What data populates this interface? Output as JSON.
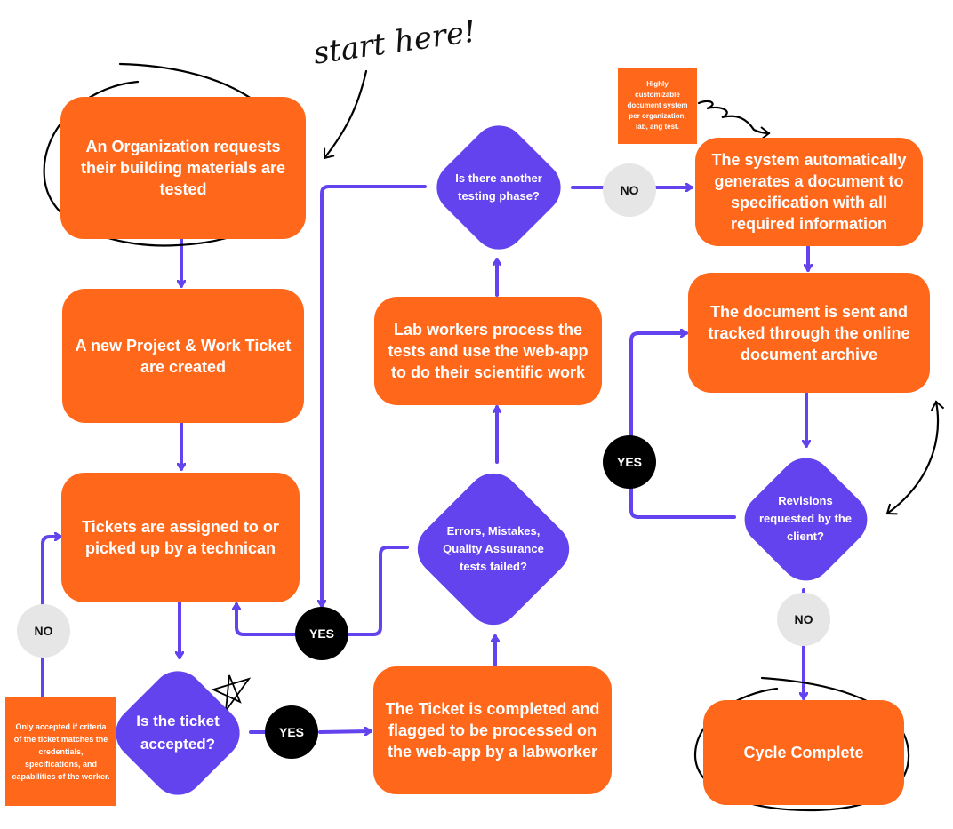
{
  "colors": {
    "process": "#FF671B",
    "decision": "#6243EE",
    "connector": "#6243EE",
    "yes_badge": "#000000",
    "no_badge": "#E6E6E6",
    "ink": "#000000"
  },
  "annotation": {
    "start_label": "start here!"
  },
  "nodes": {
    "org_request": "An Organization requests their building materials are tested",
    "new_ticket": "A new Project & Work Ticket are created",
    "assigned": "Tickets are assigned to or picked up by a technican",
    "accepted_q": "Is the ticket accepted?",
    "ticket_completed": "The Ticket is completed and flagged to be processed on the web-app by a labworker",
    "qa_failed_q": "Errors, Mistakes, Quality Assurance tests failed?",
    "lab_workers": "Lab workers process the tests and use the web-app to do their scientific work",
    "another_phase_q": "Is there another testing phase?",
    "auto_generate": "The system automatically generates a document to specification with all required information",
    "doc_sent": "The document is sent and tracked through the online document archive",
    "revisions_q": "Revisions requested by the client?",
    "cycle_complete": "Cycle Complete"
  },
  "notes": {
    "customizable": "Highly customizable document system per organization, lab, ang test.",
    "accept_criteria": "Only accepted if criteria of the ticket matches the credentials, specifications, and capabilities of the worker."
  },
  "badges": {
    "no_accept": "NO",
    "yes_accept": "YES",
    "yes_qa": "YES",
    "no_phase": "NO",
    "yes_revisions": "YES",
    "no_revisions": "NO"
  }
}
